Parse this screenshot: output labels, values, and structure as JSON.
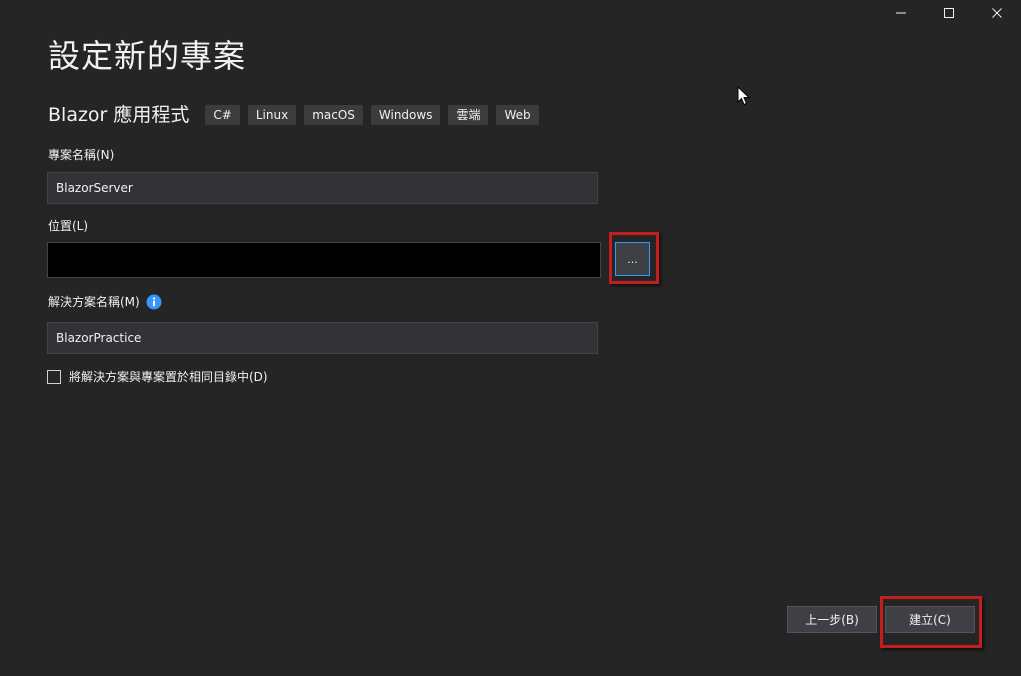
{
  "window": {
    "controls": [
      "minimize-icon",
      "maximize-icon",
      "close-icon"
    ]
  },
  "header": {
    "title": "設定新的專案"
  },
  "template": {
    "name": "Blazor 應用程式",
    "tags": [
      "C#",
      "Linux",
      "macOS",
      "Windows",
      "雲端",
      "Web"
    ]
  },
  "form": {
    "project_name": {
      "label": "專案名稱(N)",
      "value": "BlazorServer"
    },
    "location": {
      "label": "位置(L)",
      "value": "",
      "browse_label": "..."
    },
    "solution_name": {
      "label": "解決方案名稱(M)",
      "value": "BlazorPractice",
      "info_icon": "info-icon"
    },
    "same_directory": {
      "label": "將解決方案與專案置於相同目錄中(D)",
      "checked": false
    }
  },
  "footer": {
    "back_label": "上一步(B)",
    "create_label": "建立(C)"
  },
  "colors": {
    "background": "#252526",
    "input_bg": "#333337",
    "tag_bg": "#3c3c3c",
    "highlight": "#c21e1e",
    "focus_border": "#3399ff",
    "info_blue": "#3794ff"
  }
}
